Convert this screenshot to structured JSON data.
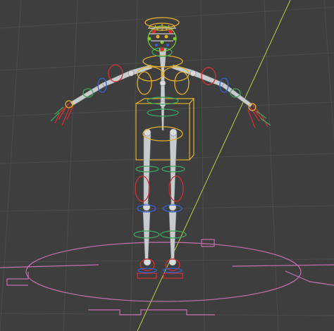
{
  "viewport": {
    "name": "3d-viewport",
    "background": "#3e3e3e",
    "grid_color": "#4a4a4a",
    "axis_line_color": "#b9d046",
    "ground_circle_color": "#c66fae",
    "bone_color": "#c9cccf",
    "selected_outline_color": "#e3b22a",
    "ik_control_color": "#d23030",
    "fk_control_color": "#3aa85c",
    "bend_control_color": "#2f64d8",
    "face_control_color": "#7ccb2e"
  },
  "scene": {
    "object": "armature-rig",
    "controls": [
      "root-control",
      "hips-box-control",
      "chest-ring-controls",
      "head-halo-control",
      "face-rig-controls",
      "arm-ik-chains",
      "leg-ik-chains",
      "foot-controls"
    ]
  }
}
